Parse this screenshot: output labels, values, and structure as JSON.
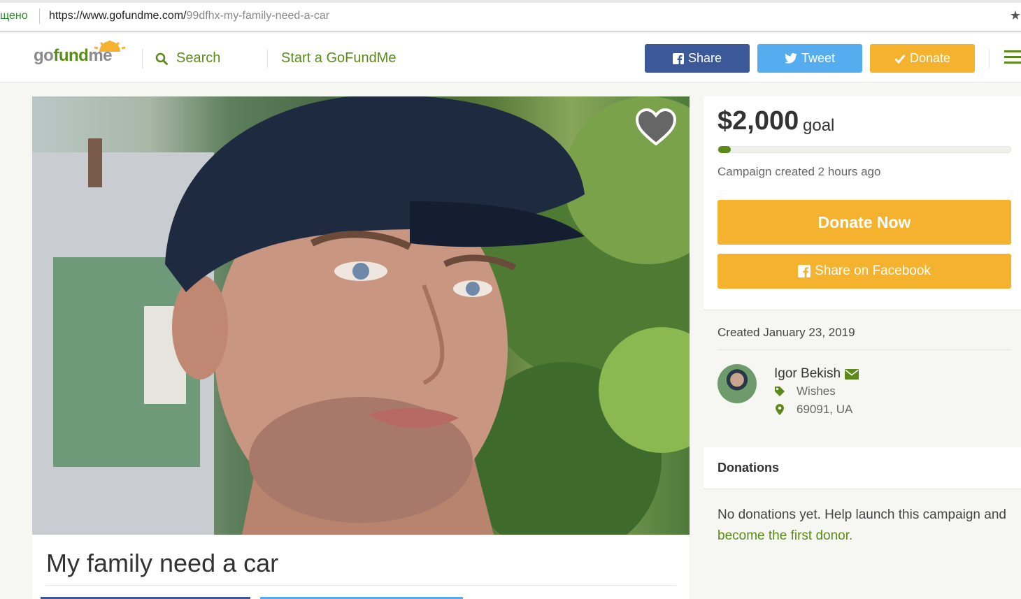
{
  "browser": {
    "secure_label": "щено",
    "url_host": "https://www.gofundme.com/",
    "url_path": "99dfhx-my-family-need-a-car",
    "star_icon": "star-icon"
  },
  "header": {
    "logo": {
      "go": "go",
      "fund": "fund",
      "me": "me"
    },
    "search_label": "Search",
    "start_label": "Start a GoFundMe",
    "share_label": "Share",
    "tweet_label": "Tweet",
    "donate_label": "Donate"
  },
  "campaign": {
    "title": "My family need a car",
    "goal_amount": "$2,000",
    "goal_word": "goal",
    "progress_fraction": 0.02,
    "created_ago": "Campaign created 2 hours ago",
    "donate_now_label": "Donate Now",
    "share_facebook_label": "Share on Facebook",
    "created_date": "Created January 23, 2019"
  },
  "organizer": {
    "name": "Igor Bekish",
    "category": "Wishes",
    "location": "69091, UA"
  },
  "donations": {
    "heading": "Donations",
    "empty_text": "No donations yet. Help launch this campaign and ",
    "empty_link": "become the first donor."
  },
  "colors": {
    "brand_green": "#5b8a1a",
    "facebook_blue": "#3b5998",
    "twitter_blue": "#55acee",
    "donate_orange": "#f5b22e"
  }
}
